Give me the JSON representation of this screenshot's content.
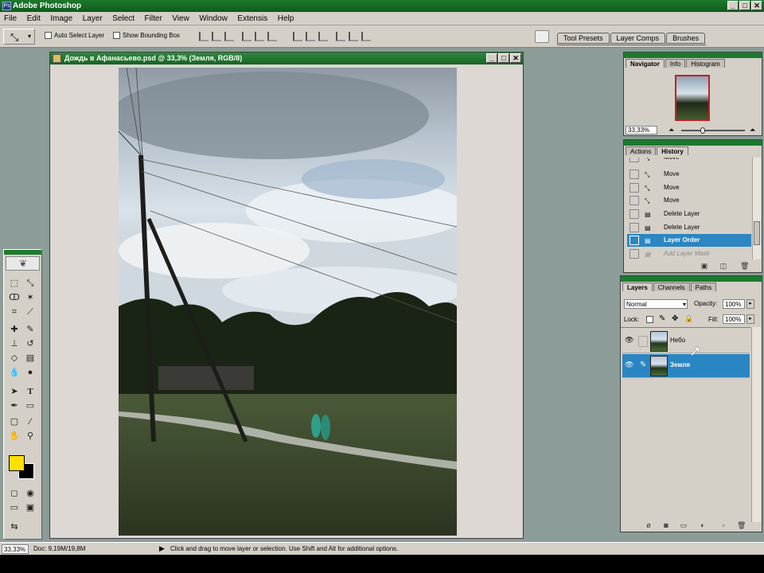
{
  "app": {
    "title": "Adobe Photoshop",
    "icon_text": "Ps"
  },
  "window_buttons": {
    "minimize": "_",
    "maximize": "□",
    "close": "✕"
  },
  "menu": [
    "File",
    "Edit",
    "Image",
    "Layer",
    "Select",
    "Filter",
    "View",
    "Window",
    "Extensis",
    "Help"
  ],
  "options": {
    "auto_select_layer": "Auto Select Layer",
    "show_bounding_box": "Show Bounding Box",
    "palette_tabs": [
      "Tool Presets",
      "Layer Comps",
      "Brushes"
    ]
  },
  "document": {
    "title": "Дождь в Афанасьево.psd @ 33,3% (Земля, RGB/8)"
  },
  "navigator": {
    "tabs": [
      "Navigator",
      "Info",
      "Histogram"
    ],
    "zoom": "33,33%"
  },
  "history": {
    "tabs": [
      "Actions",
      "History"
    ],
    "items": [
      {
        "label": "Move",
        "selected": false
      },
      {
        "label": "Move",
        "selected": false
      },
      {
        "label": "Move",
        "selected": false
      },
      {
        "label": "Move",
        "selected": false
      },
      {
        "label": "Delete Layer",
        "selected": false
      },
      {
        "label": "Delete Layer",
        "selected": false
      },
      {
        "label": "Layer Order",
        "selected": true
      },
      {
        "label": "Add Layer Mask",
        "selected": false
      }
    ]
  },
  "layers": {
    "tabs": [
      "Layers",
      "Channels",
      "Paths"
    ],
    "blend_mode": "Normal",
    "opacity_label": "Opacity:",
    "opacity": "100%",
    "lock_label": "Lock:",
    "fill_label": "Fill:",
    "fill": "100%",
    "items": [
      {
        "name": "Небо",
        "selected": false
      },
      {
        "name": "Земля",
        "selected": true
      }
    ]
  },
  "status": {
    "zoom": "33,33%",
    "doc": "Doc: 9,19M/19,8M",
    "hint": "Click and drag to move layer or selection.  Use Shift and Alt for additional options."
  },
  "colors": {
    "title_green": "#1c7a2c",
    "selection_blue": "#2b86c2",
    "foreground": "#ffe000",
    "background": "#000000"
  }
}
